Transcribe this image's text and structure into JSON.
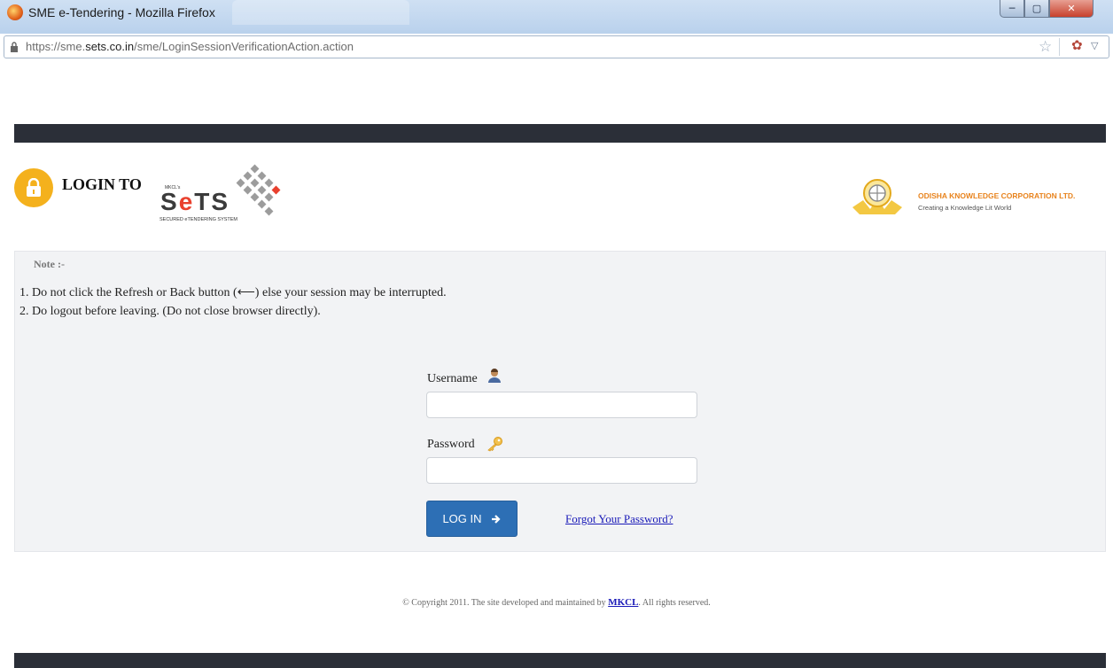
{
  "browser": {
    "window_title": "SME e-Tendering - Mozilla Firefox",
    "url_prefix": "https://sme.",
    "url_domain": "sets.co.in",
    "url_path": "/sme/LoginSessionVerificationAction.action"
  },
  "header": {
    "login_to": "LOGIN TO",
    "sets_logo": {
      "small_text": "MKCL's",
      "text_a": "S",
      "text_b": "e",
      "text_c": "TS",
      "subtitle": "SECURED eTENDERING SYSTEM"
    },
    "partner": {
      "name": "ODISHA KNOWLEDGE CORPORATION LTD.",
      "tagline": "Creating a Knowledge Lit World"
    }
  },
  "notes": {
    "label": "Note :-",
    "line1": "1. Do not click the Refresh or Back button (⟵) else your session may be interrupted.",
    "line2": "2. Do logout before leaving. (Do not close browser directly)."
  },
  "form": {
    "username_label": "Username",
    "username_value": "",
    "password_label": "Password",
    "password_value": "",
    "login_label": "LOG IN",
    "forgot_label": "Forgot Your Password?"
  },
  "footer": {
    "copyright_pre": "© Copyright 2011. The site developed and maintained by",
    "copyright_link": "MKCL",
    "copyright_post": ". All rights reserved."
  },
  "colors": {
    "band": "#2b2f38",
    "lock_circle": "#f4b11d",
    "login_button": "#2d6fb5",
    "panel": "#f2f3f5",
    "link": "#1a1ab8"
  }
}
